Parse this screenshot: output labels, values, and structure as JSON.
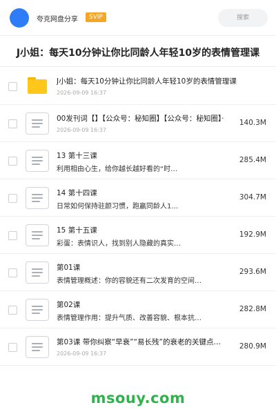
{
  "header": {
    "app_name": "夸克网盘分享",
    "badge": "SVIP",
    "search_label": "搜索"
  },
  "title": "J小姐：每天10分钟让你比同龄人年轻10岁的表情管理课",
  "files": [
    {
      "type": "folder",
      "name": "J小姐：每天10分钟让你比同龄人年轻10岁的表情管理课",
      "date": "2026-09-09 16:37",
      "size": ""
    },
    {
      "type": "doc",
      "name": "00发刊词【】【公众号：秘知圈】【公众号：秘知圈】·",
      "date": "2026-09-09 16:37",
      "size": "140.3M"
    },
    {
      "type": "doc",
      "name": "13 第十三课",
      "date": "",
      "size": "285.4M"
    },
    {
      "type": "doc",
      "name": "14 第十四课",
      "date": "",
      "size": "304.7M"
    },
    {
      "type": "doc",
      "name": "15 第十五课",
      "date": "",
      "size": "192.9M"
    },
    {
      "type": "doc",
      "name": "第01课",
      "date": "",
      "size": "293.6M"
    },
    {
      "type": "doc",
      "name": "第02课",
      "date": "",
      "size": "282.8M"
    },
    {
      "type": "doc",
      "name": "第03课 带你纠察“早衰”“易长残”的衰老的关键点…",
      "date": "2026-09-09 16:37",
      "size": "280.9M"
    }
  ],
  "subtitles": [
    "利用相由心生，给你越长越好看的“时…",
    "日常如何保持驻颜习惯，跑赢同龄人1…",
    "彩蛋：表情识人，找到别人隐藏的真实…",
    "表情管理概述：你的容貌还有二次发育的空间…",
    "表情管理作用：提升气质、改善容貌、根本抗…"
  ],
  "watermark": "msouy.com",
  "colors": {
    "avatar": "#2f7df6",
    "badge": "#f5a623",
    "folder": "#ffc71a",
    "watermark": "#2fb24c"
  }
}
